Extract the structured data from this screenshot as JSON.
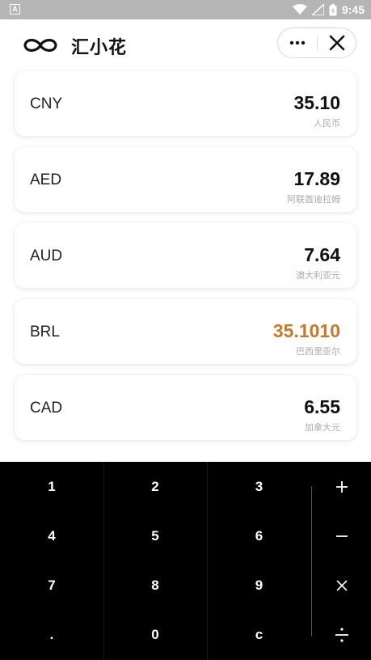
{
  "status_bar": {
    "app_icon_letter": "A",
    "time": "9:45"
  },
  "header": {
    "title": "汇小花",
    "logo_icon": "infinity-logo-icon",
    "more_icon": "more-dots-icon",
    "close_icon": "close-icon"
  },
  "currencies": [
    {
      "code": "CNY",
      "amount": "35.10",
      "name": "人民币"
    },
    {
      "code": "AED",
      "amount": "17.89",
      "name": "阿联酋迪拉姆"
    },
    {
      "code": "AUD",
      "amount": "7.64",
      "name": "澳大利亚元"
    },
    {
      "code": "BRL",
      "amount": "35.1010",
      "name": "巴西里亚尔"
    },
    {
      "code": "CAD",
      "amount": "6.55",
      "name": "加拿大元"
    }
  ],
  "keypad": {
    "rows": [
      [
        "1",
        "2",
        "3"
      ],
      [
        "4",
        "5",
        "6"
      ],
      [
        "7",
        "8",
        "9"
      ],
      [
        ".",
        "0",
        "c"
      ]
    ],
    "operators": [
      "plus-icon",
      "minus-icon",
      "multiply-icon",
      "divide-icon"
    ]
  },
  "colors": {
    "active_amount": "#c9782a",
    "keypad_bg": "#000000"
  }
}
